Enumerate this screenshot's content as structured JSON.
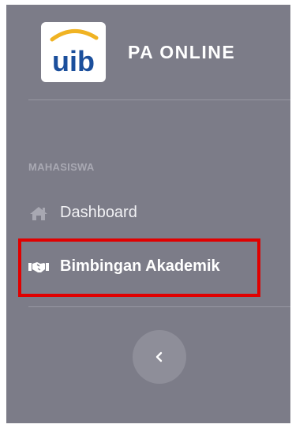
{
  "brand": {
    "logo_text": "uib",
    "title": "PA ONLINE"
  },
  "sidebar": {
    "section_label": "MAHASISWA",
    "items": [
      {
        "label": "Dashboard",
        "icon": "home-icon",
        "active": false
      },
      {
        "label": "Bimbingan Akademik",
        "icon": "handshake-icon",
        "active": true
      }
    ],
    "collapse_icon": "chevron-left-icon"
  },
  "colors": {
    "sidebar_bg": "#7c7c88",
    "highlight_border": "#e00000",
    "logo_blue": "#1b4f9c",
    "logo_arc": "#f0b323"
  }
}
